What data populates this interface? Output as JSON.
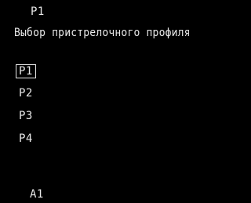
{
  "header": {
    "active_profile": "P1",
    "title": "Выбор пристрелочного профиля"
  },
  "menu": {
    "items": [
      {
        "label": "P1",
        "selected": true
      },
      {
        "label": "P2",
        "selected": false
      },
      {
        "label": "P3",
        "selected": false
      },
      {
        "label": "P4",
        "selected": false
      }
    ]
  },
  "footer": {
    "mode": "A1"
  },
  "colors": {
    "background": "#000000",
    "text": "#e8e8e8"
  }
}
